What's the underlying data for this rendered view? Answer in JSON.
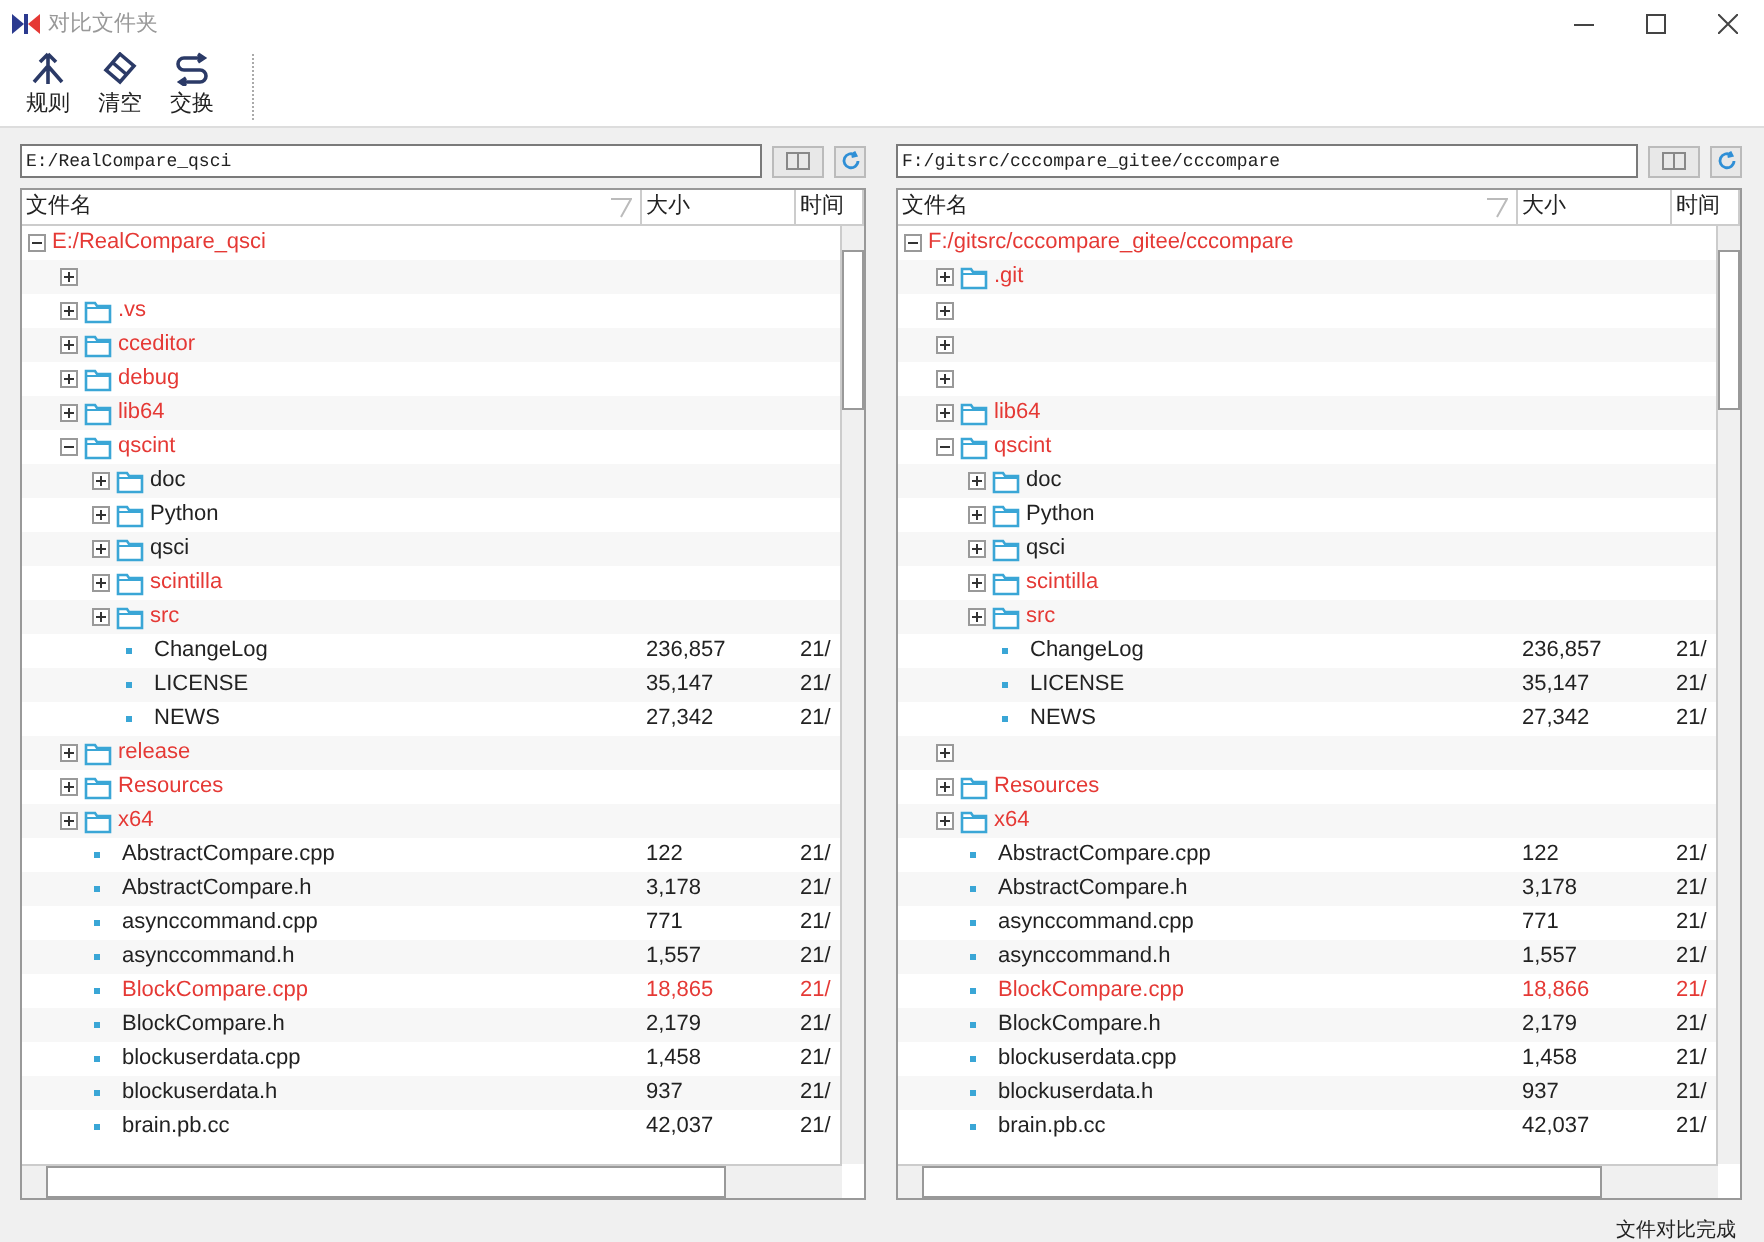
{
  "window": {
    "title": "对比文件夹"
  },
  "toolbar": [
    {
      "label": "规则",
      "kind": "rules"
    },
    {
      "label": "清空",
      "kind": "clear"
    },
    {
      "label": "交换",
      "kind": "swap"
    }
  ],
  "panes": [
    {
      "path": "E:/RealCompare_qsci",
      "columns": [
        "文件名",
        "大小",
        "时间"
      ],
      "tree": [
        {
          "kind": "root",
          "name": "E:/RealCompare_qsci",
          "expanded": true,
          "differs": true,
          "children": [
            {
              "kind": "blank",
              "expanded": false
            },
            {
              "kind": "folder",
              "name": ".vs",
              "expanded": false,
              "differs": true
            },
            {
              "kind": "folder",
              "name": "cceditor",
              "expanded": false,
              "differs": true
            },
            {
              "kind": "folder",
              "name": "debug",
              "expanded": false,
              "differs": true
            },
            {
              "kind": "folder",
              "name": "lib64",
              "expanded": false,
              "differs": true
            },
            {
              "kind": "folder",
              "name": "qscint",
              "expanded": true,
              "differs": true,
              "children": [
                {
                  "kind": "folder",
                  "name": "doc",
                  "expanded": false,
                  "differs": false
                },
                {
                  "kind": "folder",
                  "name": "Python",
                  "expanded": false,
                  "differs": false
                },
                {
                  "kind": "folder",
                  "name": "qsci",
                  "expanded": false,
                  "differs": false
                },
                {
                  "kind": "folder",
                  "name": "scintilla",
                  "expanded": false,
                  "differs": true
                },
                {
                  "kind": "folder",
                  "name": "src",
                  "expanded": false,
                  "differs": true
                },
                {
                  "kind": "file",
                  "name": "ChangeLog",
                  "size": "236,857",
                  "time": "21/",
                  "differs": false
                },
                {
                  "kind": "file",
                  "name": "LICENSE",
                  "size": "35,147",
                  "time": "21/",
                  "differs": false
                },
                {
                  "kind": "file",
                  "name": "NEWS",
                  "size": "27,342",
                  "time": "21/",
                  "differs": false
                }
              ]
            },
            {
              "kind": "folder",
              "name": "release",
              "expanded": false,
              "differs": true
            },
            {
              "kind": "folder",
              "name": "Resources",
              "expanded": false,
              "differs": true
            },
            {
              "kind": "folder",
              "name": "x64",
              "expanded": false,
              "differs": true
            },
            {
              "kind": "file",
              "name": "AbstractCompare.cpp",
              "size": "122",
              "time": "21/",
              "differs": false
            },
            {
              "kind": "file",
              "name": "AbstractCompare.h",
              "size": "3,178",
              "time": "21/",
              "differs": false
            },
            {
              "kind": "file",
              "name": "asynccommand.cpp",
              "size": "771",
              "time": "21/",
              "differs": false
            },
            {
              "kind": "file",
              "name": "asynccommand.h",
              "size": "1,557",
              "time": "21/",
              "differs": false
            },
            {
              "kind": "file",
              "name": "BlockCompare.cpp",
              "size": "18,865",
              "time": "21/",
              "differs": true
            },
            {
              "kind": "file",
              "name": "BlockCompare.h",
              "size": "2,179",
              "time": "21/",
              "differs": false
            },
            {
              "kind": "file",
              "name": "blockuserdata.cpp",
              "size": "1,458",
              "time": "21/",
              "differs": false
            },
            {
              "kind": "file",
              "name": "blockuserdata.h",
              "size": "937",
              "time": "21/",
              "differs": false
            },
            {
              "kind": "file",
              "name": "brain.pb.cc",
              "size": "42,037",
              "time": "21/",
              "differs": false
            }
          ]
        }
      ]
    },
    {
      "path": "F:/gitsrc/cccompare_gitee/cccompare",
      "columns": [
        "文件名",
        "大小",
        "时间"
      ],
      "tree": [
        {
          "kind": "root",
          "name": "F:/gitsrc/cccompare_gitee/cccompare",
          "expanded": true,
          "differs": true,
          "children": [
            {
              "kind": "folder",
              "name": ".git",
              "expanded": false,
              "differs": true
            },
            {
              "kind": "blank",
              "expanded": false
            },
            {
              "kind": "blank",
              "expanded": false
            },
            {
              "kind": "blank",
              "expanded": false
            },
            {
              "kind": "folder",
              "name": "lib64",
              "expanded": false,
              "differs": true
            },
            {
              "kind": "folder",
              "name": "qscint",
              "expanded": true,
              "differs": true,
              "children": [
                {
                  "kind": "folder",
                  "name": "doc",
                  "expanded": false,
                  "differs": false
                },
                {
                  "kind": "folder",
                  "name": "Python",
                  "expanded": false,
                  "differs": false
                },
                {
                  "kind": "folder",
                  "name": "qsci",
                  "expanded": false,
                  "differs": false
                },
                {
                  "kind": "folder",
                  "name": "scintilla",
                  "expanded": false,
                  "differs": true
                },
                {
                  "kind": "folder",
                  "name": "src",
                  "expanded": false,
                  "differs": true
                },
                {
                  "kind": "file",
                  "name": "ChangeLog",
                  "size": "236,857",
                  "time": "21/",
                  "differs": false
                },
                {
                  "kind": "file",
                  "name": "LICENSE",
                  "size": "35,147",
                  "time": "21/",
                  "differs": false
                },
                {
                  "kind": "file",
                  "name": "NEWS",
                  "size": "27,342",
                  "time": "21/",
                  "differs": false
                }
              ]
            },
            {
              "kind": "blank",
              "expanded": false
            },
            {
              "kind": "folder",
              "name": "Resources",
              "expanded": false,
              "differs": true
            },
            {
              "kind": "folder",
              "name": "x64",
              "expanded": false,
              "differs": true
            },
            {
              "kind": "file",
              "name": "AbstractCompare.cpp",
              "size": "122",
              "time": "21/",
              "differs": false
            },
            {
              "kind": "file",
              "name": "AbstractCompare.h",
              "size": "3,178",
              "time": "21/",
              "differs": false
            },
            {
              "kind": "file",
              "name": "asynccommand.cpp",
              "size": "771",
              "time": "21/",
              "differs": false
            },
            {
              "kind": "file",
              "name": "asynccommand.h",
              "size": "1,557",
              "time": "21/",
              "differs": false
            },
            {
              "kind": "file",
              "name": "BlockCompare.cpp",
              "size": "18,866",
              "time": "21/",
              "differs": true
            },
            {
              "kind": "file",
              "name": "BlockCompare.h",
              "size": "2,179",
              "time": "21/",
              "differs": false
            },
            {
              "kind": "file",
              "name": "blockuserdata.cpp",
              "size": "1,458",
              "time": "21/",
              "differs": false
            },
            {
              "kind": "file",
              "name": "blockuserdata.h",
              "size": "937",
              "time": "21/",
              "differs": false
            },
            {
              "kind": "file",
              "name": "brain.pb.cc",
              "size": "42,037",
              "time": "21/",
              "differs": false
            }
          ]
        }
      ]
    }
  ],
  "status_bar": "文件对比完成"
}
